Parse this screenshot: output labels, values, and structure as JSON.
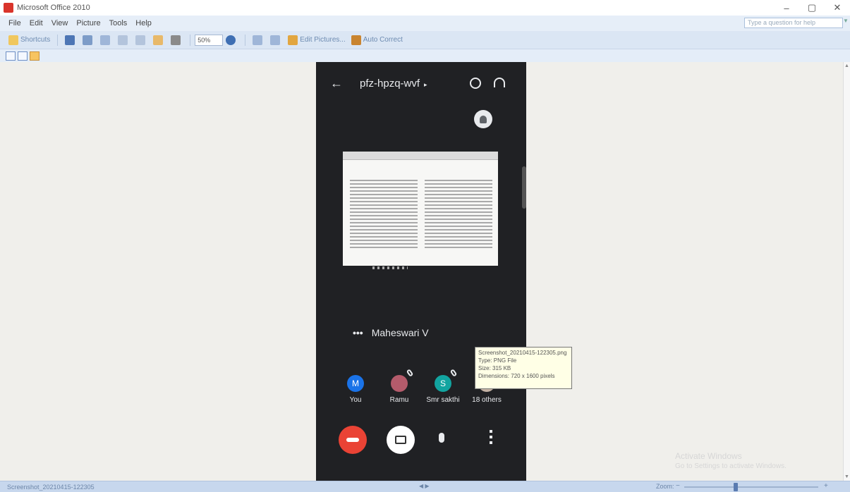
{
  "window": {
    "title": "Microsoft Office 2010",
    "controls": {
      "minimize": "–",
      "restore": "▢",
      "close": "✕"
    }
  },
  "menubar": {
    "items": [
      "File",
      "Edit",
      "View",
      "Picture",
      "Tools",
      "Help"
    ],
    "help_placeholder": "Type a question for help"
  },
  "toolbar": {
    "shortcuts_label": "Shortcuts",
    "zoom_value": "50%",
    "edit_pictures_label": "Edit Pictures...",
    "auto_correct_label": "Auto Correct"
  },
  "meet": {
    "meeting_code": "pfz-hpzq-wvf",
    "presenter_name": "Maheswari V",
    "participants": [
      {
        "initial": "M",
        "name": "You",
        "color": "#1a73e8"
      },
      {
        "initial": "",
        "name": "Ramu",
        "color": "#5f6368"
      },
      {
        "initial": "S",
        "name": "Smr sakthi",
        "color": "#12a4a0"
      },
      {
        "initial": "",
        "name": "18 others",
        "color": "#c4b2a4"
      }
    ]
  },
  "tooltip": {
    "filename": "Screenshot_20210415-122305.png",
    "type": "Type: PNG File",
    "size": "Size: 315 KB",
    "dimensions": "Dimensions: 720 x 1600 pixels"
  },
  "activation": {
    "title": "Activate Windows",
    "subtitle": "Go to Settings to activate Windows."
  },
  "statusbar": {
    "filename": "Screenshot_20210415-122305",
    "zoom_label": "Zoom:"
  }
}
